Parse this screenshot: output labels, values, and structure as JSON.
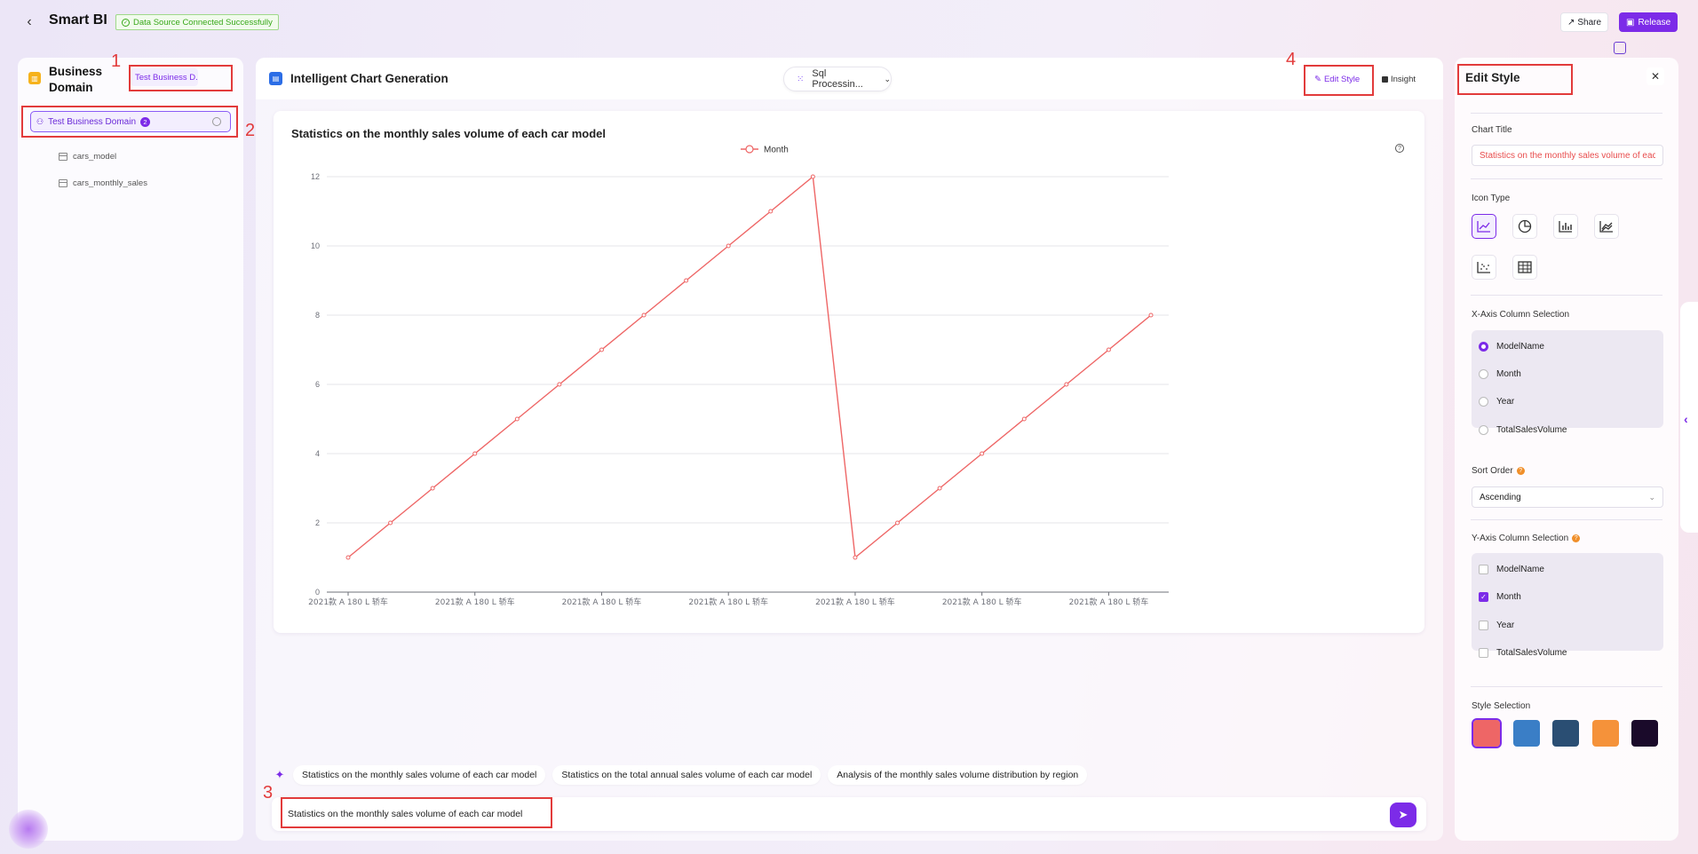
{
  "header": {
    "app_title": "Smart BI",
    "connection_status": "Data Source Connected Successfully",
    "share_label": "Share",
    "release_label": "Release"
  },
  "left": {
    "title": "Business Domain",
    "domain_select": "Test Business D...",
    "tree_root_label": "Test Business Domain",
    "tree_root_count": "2",
    "tables": [
      "cars_model",
      "cars_monthly_sales"
    ]
  },
  "center": {
    "title": "Intelligent Chart Generation",
    "sql_select": "Sql Processin...",
    "edit_style_label": "Edit Style",
    "insight_label": "Insight",
    "suggestions": [
      "Statistics on the monthly sales volume of each car model",
      "Statistics on the total annual sales volume of each car model",
      "Analysis of the monthly sales volume distribution by region"
    ],
    "chat_value": "Statistics on the monthly sales volume of each car model"
  },
  "chart_data": {
    "type": "line",
    "title": "Statistics on the monthly sales volume of each car model",
    "legend": [
      "Month"
    ],
    "legend_position": "top-center",
    "color": "#ee6666",
    "grid": true,
    "ylim": [
      0,
      12
    ],
    "yticks": [
      0,
      2,
      4,
      6,
      8,
      10,
      12
    ],
    "x_tick_label": "2021款 A 180 L 轿车",
    "x_tick_count": 7,
    "series": [
      {
        "name": "Month",
        "values": [
          1,
          2,
          3,
          4,
          5,
          6,
          7,
          8,
          9,
          10,
          11,
          12,
          1,
          2,
          3,
          4,
          5,
          6,
          7,
          8
        ]
      }
    ]
  },
  "right": {
    "title": "Edit Style",
    "chart_title_label": "Chart Title",
    "chart_title_value": "Statistics on the monthly sales volume of each car model",
    "icon_type_label": "Icon Type",
    "icon_types": [
      "line-chart-icon",
      "pie-chart-icon",
      "bar-chart-icon",
      "area-chart-icon",
      "scatter-chart-icon",
      "table-icon"
    ],
    "x_axis_label": "X-Axis Column Selection",
    "x_axis_options": [
      "ModelName",
      "Month",
      "Year",
      "TotalSalesVolume"
    ],
    "x_axis_selected": "ModelName",
    "sort_order_label": "Sort Order",
    "sort_order_value": "Ascending",
    "y_axis_label": "Y-Axis Column Selection",
    "y_axis_options": [
      "ModelName",
      "Month",
      "Year",
      "TotalSalesVolume"
    ],
    "y_axis_checked": [
      "Month"
    ],
    "style_selection_label": "Style Selection",
    "style_colors": [
      "#ee6666",
      "#3a7ec6",
      "#2a4e73",
      "#f5923a",
      "#1a0a2a"
    ]
  },
  "annotations": [
    "1",
    "2",
    "3",
    "4"
  ]
}
